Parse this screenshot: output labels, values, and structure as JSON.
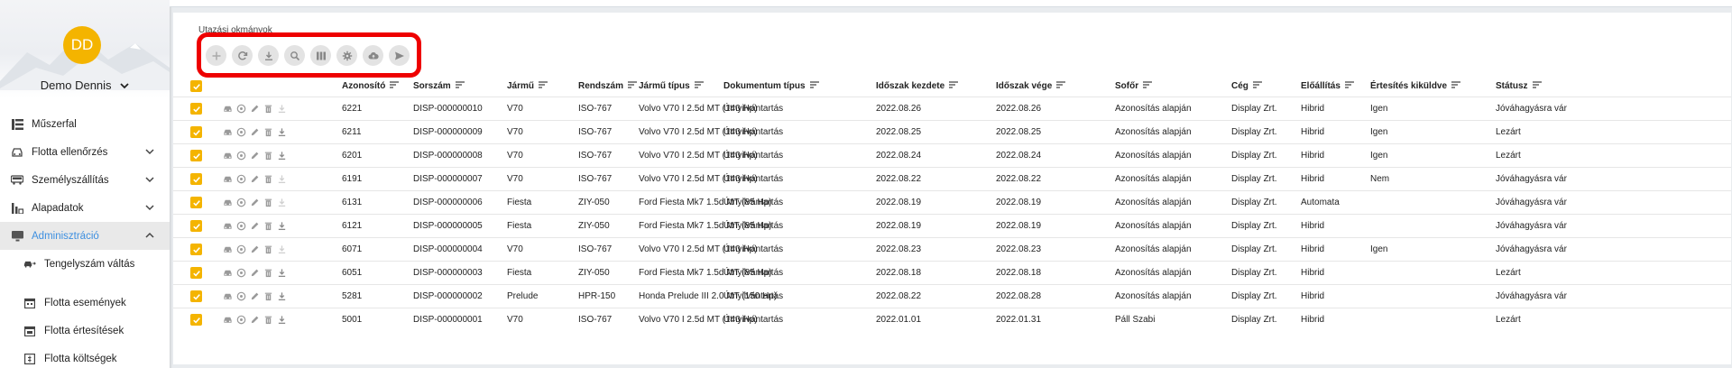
{
  "user": {
    "initials": "DD",
    "name": "Demo Dennis",
    "avatar_color": "#f4b400"
  },
  "nav": {
    "items": [
      {
        "label": "Műszerfal",
        "icon": "dashboard-icon",
        "has_arrow": false
      },
      {
        "label": "Flotta ellenőrzés",
        "icon": "car-check-icon",
        "has_arrow": true,
        "arrow": "down"
      },
      {
        "label": "Személyszállítás",
        "icon": "bus-icon",
        "has_arrow": true,
        "arrow": "down"
      },
      {
        "label": "Alapadatok",
        "icon": "database-icon",
        "has_arrow": true,
        "arrow": "down"
      },
      {
        "label": "Adminisztráció",
        "icon": "monitor-icon",
        "has_arrow": true,
        "arrow": "up",
        "active": true
      },
      {
        "label": "Tengelyszám váltás",
        "icon": "car-swap-icon",
        "has_arrow": false,
        "sub": true
      },
      {
        "label": "Flotta események",
        "icon": "calendar-events-icon",
        "has_arrow": false,
        "sub": true
      },
      {
        "label": "Flotta értesítések",
        "icon": "calendar-notify-icon",
        "has_arrow": false,
        "sub": true
      },
      {
        "label": "Flotta költségek",
        "icon": "cost-icon",
        "has_arrow": false,
        "sub": true
      }
    ]
  },
  "page": {
    "title": "Utazási okmányok"
  },
  "toolbar": [
    "add-icon",
    "refresh-icon",
    "download-icon",
    "search-icon",
    "columns-icon",
    "settings-icon",
    "cloud-upload-icon",
    "send-icon"
  ],
  "colors": {
    "accent": "#f4b400",
    "active_nav": "#3d8fe0",
    "highlight_outline": "#ee0000"
  },
  "table": {
    "headers": [
      "Azonosító",
      "Sorszám",
      "Jármű",
      "Rendszám",
      "Jármű típus",
      "Dokumentum típus",
      "Időszak kezdete",
      "Időszak vége",
      "Sofőr",
      "Cég",
      "Előállítás",
      "Értesítés kiküldve",
      "Státusz"
    ],
    "rows": [
      [
        "6221",
        "DISP-000000010",
        "V70",
        "ISO-767",
        "Volvo V70 I 2.5d MT (140 Hp)",
        "Útnyilvántartás",
        "2022.08.26",
        "2022.08.26",
        "Azonosítás alapján",
        "Display Zrt.",
        "Hibrid",
        "Igen",
        "Jóváhagyásra vár"
      ],
      [
        "6211",
        "DISP-000000009",
        "V70",
        "ISO-767",
        "Volvo V70 I 2.5d MT (140 Hp)",
        "Útnyilvántartás",
        "2022.08.25",
        "2022.08.25",
        "Azonosítás alapján",
        "Display Zrt.",
        "Hibrid",
        "Igen",
        "Lezárt"
      ],
      [
        "6201",
        "DISP-000000008",
        "V70",
        "ISO-767",
        "Volvo V70 I 2.5d MT (140 Hp)",
        "Útnyilvántartás",
        "2022.08.24",
        "2022.08.24",
        "Azonosítás alapján",
        "Display Zrt.",
        "Hibrid",
        "Igen",
        "Lezárt"
      ],
      [
        "6191",
        "DISP-000000007",
        "V70",
        "ISO-767",
        "Volvo V70 I 2.5d MT (140 Hp)",
        "Útnyilvántartás",
        "2022.08.22",
        "2022.08.22",
        "Azonosítás alapján",
        "Display Zrt.",
        "Hibrid",
        "Nem",
        "Jóváhagyásra vár"
      ],
      [
        "6131",
        "DISP-000000006",
        "Fiesta",
        "ZIY-050",
        "Ford Fiesta Mk7 1.5d MT (85 Hp)",
        "Útnyilvántartás",
        "2022.08.19",
        "2022.08.19",
        "Azonosítás alapján",
        "Display Zrt.",
        "Automata",
        "",
        "Jóváhagyásra vár"
      ],
      [
        "6121",
        "DISP-000000005",
        "Fiesta",
        "ZIY-050",
        "Ford Fiesta Mk7 1.5d MT (85 Hp)",
        "Útnyilvántartás",
        "2022.08.19",
        "2022.08.19",
        "Azonosítás alapján",
        "Display Zrt.",
        "Hibrid",
        "",
        "Jóváhagyásra vár"
      ],
      [
        "6071",
        "DISP-000000004",
        "V70",
        "ISO-767",
        "Volvo V70 I 2.5d MT (140 Hp)",
        "Útnyilvántartás",
        "2022.08.23",
        "2022.08.23",
        "Azonosítás alapján",
        "Display Zrt.",
        "Hibrid",
        "Igen",
        "Jóváhagyásra vár"
      ],
      [
        "6051",
        "DISP-000000003",
        "Fiesta",
        "ZIY-050",
        "Ford Fiesta Mk7 1.5d MT (85 Hp)",
        "Útnyilvántartás",
        "2022.08.18",
        "2022.08.18",
        "Azonosítás alapján",
        "Display Zrt.",
        "Hibrid",
        "",
        "Lezárt"
      ],
      [
        "5281",
        "DISP-000000002",
        "Prelude",
        "HPR-150",
        "Honda Prelude III 2.0 MT (150 Hp)",
        "Útnyilvántartás",
        "2022.08.22",
        "2022.08.28",
        "Azonosítás alapján",
        "Display Zrt.",
        "Hibrid",
        "",
        "Jóváhagyásra vár"
      ],
      [
        "5001",
        "DISP-000000001",
        "V70",
        "ISO-767",
        "Volvo V70 I 2.5d MT (140 Hp)",
        "Útnyilvántartás",
        "2022.01.01",
        "2022.01.31",
        "Páll Szabi",
        "Display Zrt.",
        "Hibrid",
        "",
        "Lezárt"
      ]
    ],
    "row_action_icons": [
      "car-icon",
      "info-circle-icon",
      "edit-icon",
      "delete-icon",
      "download-icon"
    ],
    "row_download_enabled": [
      false,
      true,
      true,
      false,
      false,
      true,
      false,
      true,
      true,
      true
    ]
  }
}
